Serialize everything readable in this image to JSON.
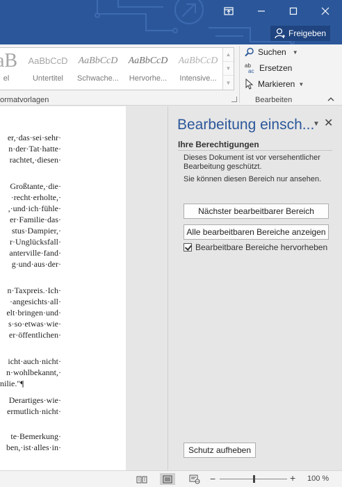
{
  "titlebar": {
    "share_label": "Freigeben",
    "colors": {
      "background": "#2b579a",
      "share_button": "#1f4480"
    },
    "icons": [
      "ribbon-display-options-icon",
      "minimize-icon",
      "maximize-icon",
      "close-icon",
      "person-icon"
    ]
  },
  "ribbon": {
    "styles": [
      {
        "sample": "aB",
        "name": "el"
      },
      {
        "sample": "AaBbCcD",
        "name": "Untertitel"
      },
      {
        "sample": "AaBbCcD",
        "name": "Schwache..."
      },
      {
        "sample": "AaBbCcD",
        "name": "Hervorhe..."
      },
      {
        "sample": "AaBbCcD",
        "name": "Intensive..."
      }
    ],
    "styles_group_label": "ormatvorlagen",
    "edit_group_label": "Bearbeiten",
    "edit_items": [
      {
        "label": "Suchen",
        "icon": "search-icon",
        "has_dropdown": true
      },
      {
        "label": "Ersetzen",
        "icon": "replace-icon",
        "has_dropdown": false
      },
      {
        "label": "Markieren",
        "icon": "select-cursor-icon",
        "has_dropdown": true
      }
    ]
  },
  "document": {
    "lines": [
      {
        "text": "er,·das·sei·sehr·"
      },
      {
        "text": "n·der·Tat·hatte·"
      },
      {
        "text": "rachtet,·diesen·"
      },
      {
        "text": "Großtante,·die·"
      },
      {
        "text": "·recht·erholte,·"
      },
      {
        "text": ",·und·ich·fühle·"
      },
      {
        "text": "er·Familie·das·"
      },
      {
        "text": "stus·Dampier,·"
      },
      {
        "text": "r·Unglücksfall·"
      },
      {
        "text": "anterville·fand·"
      },
      {
        "text": "g·und·aus·der·"
      },
      {
        "text": "n·Taxpreis.·Ich·"
      },
      {
        "text": "·angesichts·all·"
      },
      {
        "text": "elt·bringen·und·"
      },
      {
        "text": "s·so·etwas·wie·"
      },
      {
        "text": "er·öffentlichen·"
      },
      {
        "text": "icht·auch·nicht·"
      },
      {
        "text": "n·wohlbekannt,·"
      },
      {
        "text": "nilie.\"¶"
      },
      {
        "text": "Derartiges·wie·"
      },
      {
        "text": "ermutlich·nicht·"
      },
      {
        "text": "te·Bemerkung·"
      },
      {
        "text": "ben,·ist·alles·in·"
      }
    ]
  },
  "pane": {
    "title": "Bearbeitung einsch...",
    "permissions_heading": "Ihre Berechtigungen",
    "protected_text": "Dieses Dokument ist vor versehentlicher Bearbeitung geschützt.",
    "view_only_text": "Sie können diesen Bereich nur ansehen.",
    "next_region_button": "Nächster bearbeitbarer Bereich",
    "show_all_button": "Alle bearbeitbaren Bereiche anzeigen",
    "highlight_label": "Bearbeitbare Bereiche hervorheben",
    "highlight_checked": true,
    "unprotect_button": "Schutz aufheben",
    "title_color": "#2b579a"
  },
  "statusbar": {
    "zoom_label": "100 %",
    "zoom_percent": 100,
    "views": [
      "read-mode-icon",
      "print-layout-icon",
      "web-layout-icon"
    ],
    "active_view": "print-layout-icon"
  }
}
